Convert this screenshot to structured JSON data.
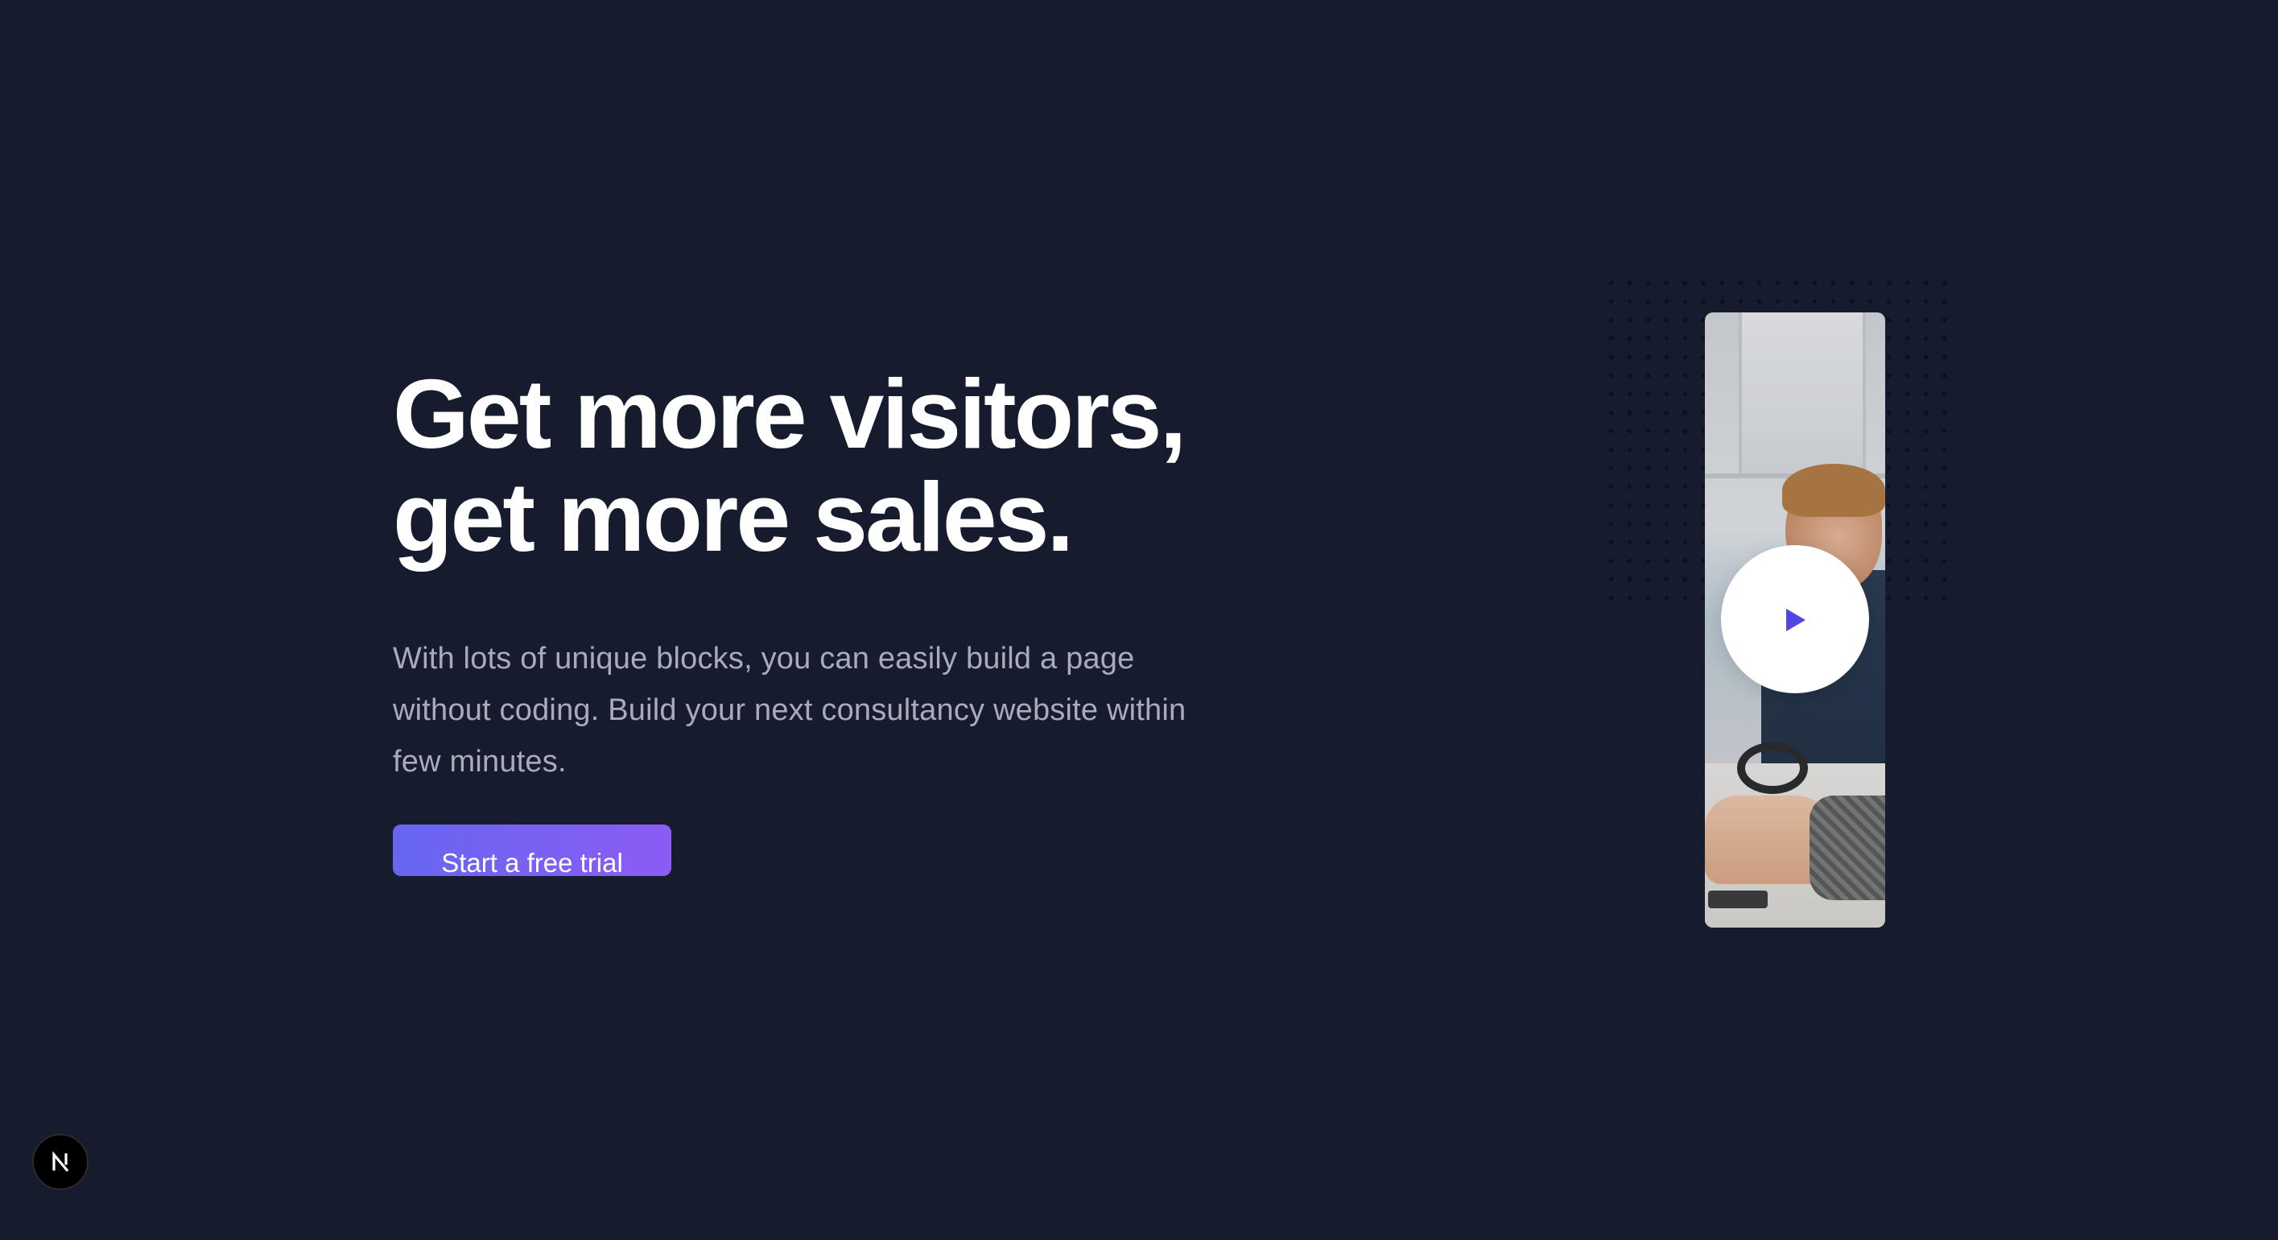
{
  "hero": {
    "headline_line1": "Get more visitors,",
    "headline_line2": "get more sales.",
    "description": "With lots of unique blocks, you can easily build a page without coding. Build your next consultancy website within few minutes.",
    "cta_label": "Start a free trial"
  },
  "media": {
    "play_icon": "play-icon",
    "image_subject": "office-worker-at-desk"
  },
  "badge": {
    "icon": "nextjs-logo-icon",
    "letter": "N"
  },
  "colors": {
    "background": "#171b2e",
    "accent_start": "#6766f1",
    "accent_end": "#8b5cf6",
    "play_icon": "#4f46e5",
    "body_text": "#a7abbb",
    "headline": "#ffffff"
  }
}
